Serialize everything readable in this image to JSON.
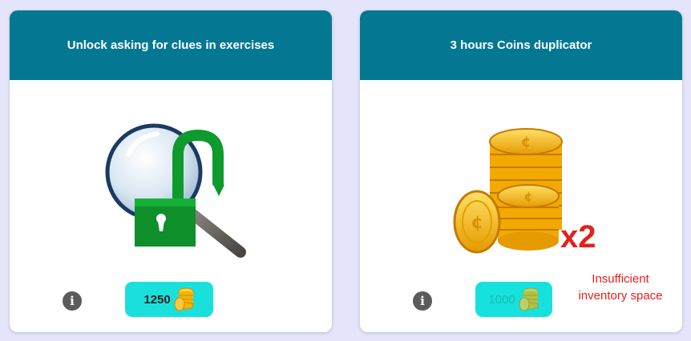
{
  "cards": [
    {
      "title": "Unlock asking for clues in exercises",
      "icon": "magnifier-unlock-icon",
      "price": "1250",
      "price_icon": "coin-stack-icon",
      "enabled": true
    },
    {
      "title": "3 hours Coins duplicator",
      "icon": "coins-duplicator-icon",
      "multiplier_label": "x2",
      "price": "1000",
      "price_icon": "coin-stack-icon",
      "enabled": false,
      "warning": "Insufficient inventory space"
    }
  ],
  "colors": {
    "background": "#e4e4fa",
    "header": "#047893",
    "price_button": "#1ae0dc",
    "warning": "#ee1c1c",
    "info_icon": "#5b5b5b",
    "lock_green": "#0f9a2e",
    "coin_gold": "#f5b400"
  }
}
